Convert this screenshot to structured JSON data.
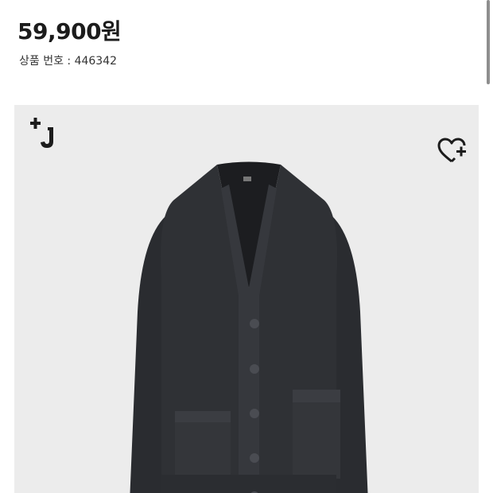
{
  "product": {
    "price": "59,900원",
    "product_number_label": "상품 번호 : 446342"
  },
  "icons": {
    "brand_logo": "plus-j-logo",
    "wishlist": "heart-plus-icon"
  },
  "colors": {
    "background": "#ffffff",
    "image_bg": "#ececec",
    "garment": "#2c2e32",
    "text": "#1c1c1c"
  }
}
